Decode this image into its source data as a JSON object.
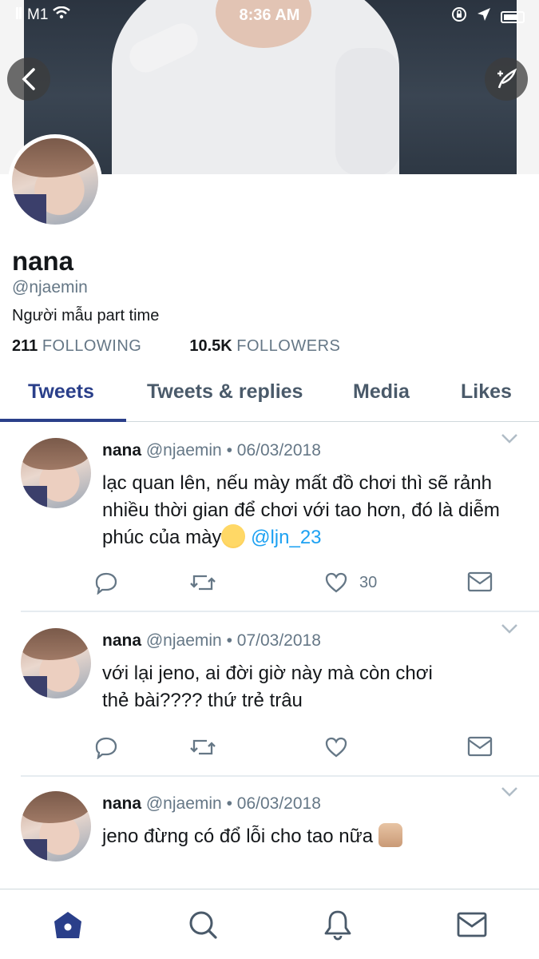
{
  "status_bar": {
    "carrier": "M1",
    "time": "8:36 AM"
  },
  "profile": {
    "name": "nana",
    "handle": "@njaemin",
    "bio": "Người mẫu part time",
    "following_count": "211",
    "following_label": "FOLLOWING",
    "followers_count": "10.5K",
    "followers_label": "FOLLOWERS"
  },
  "tabs": [
    {
      "label": "Tweets",
      "active": true
    },
    {
      "label": "Tweets & replies",
      "active": false
    },
    {
      "label": "Media",
      "active": false
    },
    {
      "label": "Likes",
      "active": false
    }
  ],
  "tweets": [
    {
      "name": "nana",
      "handle": "@njaemin",
      "separator": "•",
      "date": "06/03/2018",
      "text": "lạc quan lên, nếu mày mất đồ chơi thì sẽ rảnh nhiều thời gian để chơi với tao hơn, đó là diễm phúc của mày",
      "emoji": "relieved-face",
      "mention": "@ljn_23",
      "likes": "30"
    },
    {
      "name": "nana",
      "handle": "@njaemin",
      "separator": "•",
      "date": "07/03/2018",
      "text": "với lại jeno, ai đời giờ này mà còn chơi thẻ bài???? thứ trẻ trâu",
      "likes": ""
    },
    {
      "name": "nana",
      "handle": "@njaemin",
      "separator": "•",
      "date": "06/03/2018",
      "text": "jeno đừng có đổ lỗi cho tao nữa",
      "emoji": "raised-fist",
      "likes": ""
    }
  ],
  "icons": {
    "back": "back-arrow-icon",
    "compose": "feather-icon",
    "reply": "reply-icon",
    "retweet": "retweet-icon",
    "like": "heart-icon",
    "dm": "envelope-icon",
    "nav_home": "home-icon",
    "nav_search": "search-icon",
    "nav_notifications": "bell-icon",
    "nav_messages": "envelope-icon"
  },
  "colors": {
    "accent": "#2a3f8a",
    "mention": "#1da1f2",
    "muted": "#657786"
  }
}
